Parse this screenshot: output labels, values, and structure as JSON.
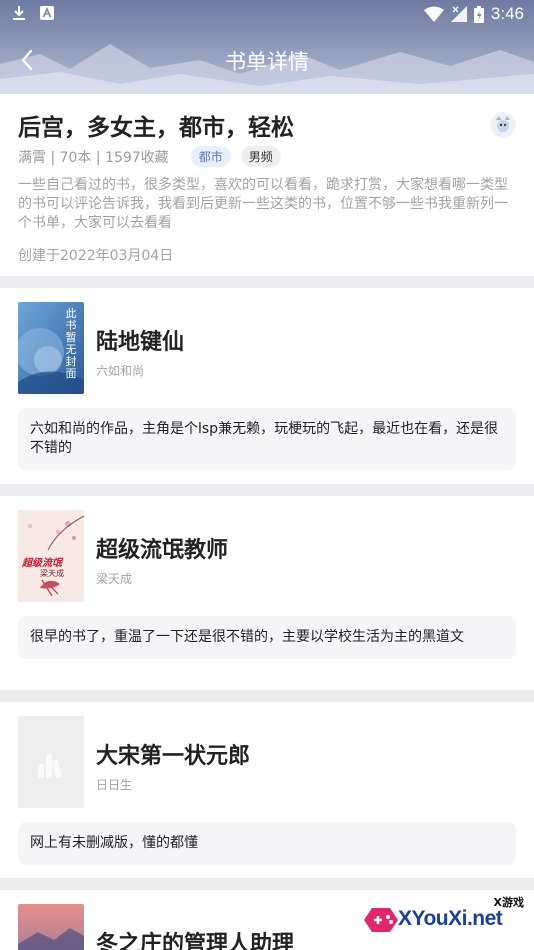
{
  "status_bar": {
    "time": "3:46",
    "icons": [
      "download-icon",
      "a-notification-icon",
      "wifi-icon",
      "no-signal-icon",
      "battery-icon"
    ]
  },
  "navbar": {
    "back_icon": "chevron-left-icon",
    "title": "书单详情"
  },
  "booklist": {
    "title": "后宫，多女主，都市，轻松",
    "author_meta": "满霄 | 70本 | 1597收藏",
    "tags": [
      "都市",
      "男频"
    ],
    "description": "一些自己看过的书，很多类型，喜欢的可以看看，跪求打赏，大家想看哪一类型的书可以评论告诉我，我看到后更新一些这类的书，位置不够一些书我重新列一个书单，大家可以去看看",
    "created": "创建于2022年03月04日"
  },
  "books": [
    {
      "title": "陆地键仙",
      "author": "六如和尚",
      "comment": "六如和尚的作品，主角是个lsp兼无赖，玩梗玩的飞起，最近也在看，还是很不错的",
      "cover_text": [
        "此",
        "书",
        "暂",
        "无",
        "封",
        "面"
      ]
    },
    {
      "title": "超级流氓教师",
      "author": "梁天成",
      "comment": "很早的书了，重温了一下还是很不错的，主要以学校生活为主的黑道文",
      "cover_text": [
        "超级流氓",
        "梁天成"
      ]
    },
    {
      "title": "大宋第一状元郎",
      "author": "日日生",
      "comment": "网上有未删减版，懂的都懂",
      "cover_text": []
    },
    {
      "title": "冬之庄的管理人助理",
      "author": "",
      "comment": "",
      "cover_text": []
    }
  ],
  "watermark": {
    "small": "X游戏",
    "logo": "XYouXi.net"
  },
  "colors": {
    "header": "#7e88ae",
    "tag_blue": "#5b78b8",
    "text_primary": "#222222",
    "text_secondary": "#a2a2a6"
  }
}
